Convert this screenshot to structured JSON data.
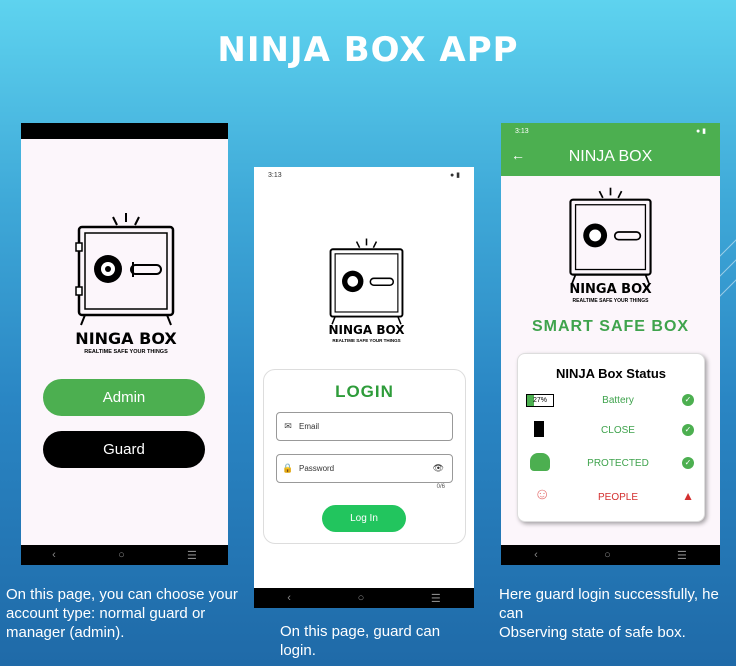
{
  "page_title": "NINJA BOX APP",
  "logo": {
    "brand": "NINGA BOX",
    "tagline": "REALTIME SAFE YOUR THINGS"
  },
  "screen1": {
    "admin_label": "Admin",
    "guard_label": "Guard"
  },
  "screen2": {
    "status_time": "3:13",
    "login_title": "LOGIN",
    "email_placeholder": "Email",
    "password_placeholder": "Password",
    "password_counter": "0/6",
    "login_button": "Log In"
  },
  "screen3": {
    "status_time": "3:13",
    "appbar_title": "NINJA BOX",
    "heading": "SMART SAFE BOX",
    "card_title": "NINJA Box Status",
    "rows": [
      {
        "icon": "battery-icon",
        "value": "27%",
        "label": "Battery",
        "state": "ok"
      },
      {
        "icon": "door-icon",
        "label": "CLOSE",
        "state": "ok"
      },
      {
        "icon": "spy-icon",
        "label": "PROTECTED",
        "state": "ok"
      },
      {
        "icon": "person-icon",
        "label": "PEOPLE",
        "state": "warning"
      }
    ]
  },
  "captions": {
    "c1": "On this page, you can choose your account type: normal guard or manager (admin).",
    "c2": "On this page, guard can login.",
    "c3": "Here guard login successfully, he can\nObserving state of safe box."
  },
  "colors": {
    "green": "#4caf50",
    "warning": "#d32f2f",
    "background": "#3fa9d8"
  }
}
